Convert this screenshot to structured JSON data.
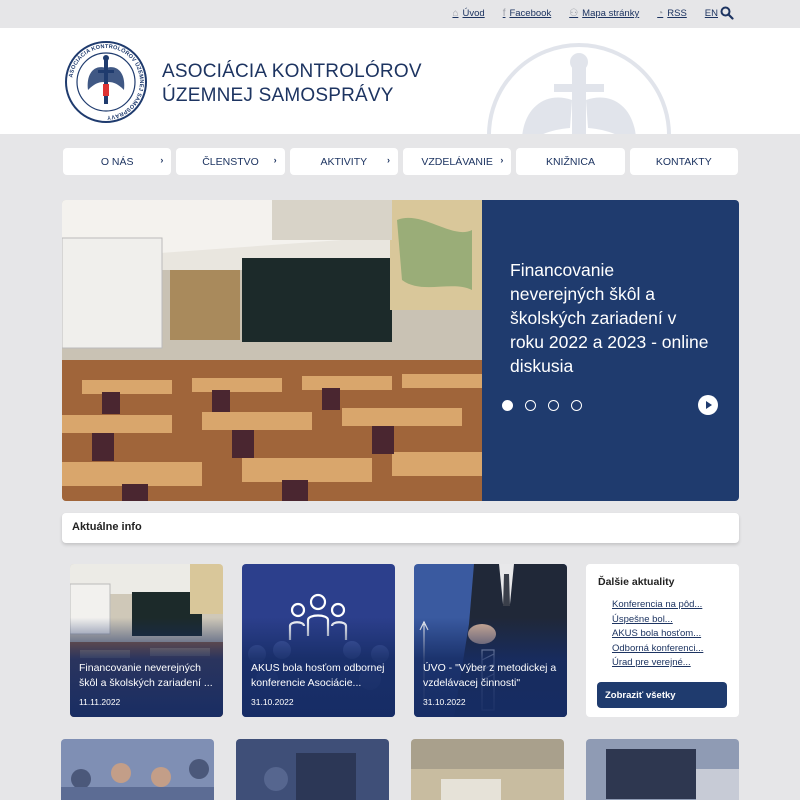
{
  "top_links": [
    {
      "label": "Úvod",
      "icon": "home-icon"
    },
    {
      "label": "Facebook",
      "icon": "facebook-icon"
    },
    {
      "label": "Mapa stránky",
      "icon": "sitemap-icon"
    },
    {
      "label": "RSS",
      "icon": "rss-icon"
    },
    {
      "label": "EN",
      "icon": ""
    }
  ],
  "brand": {
    "line1": "ASOCIÁCIA KONTROLÓROV",
    "line2": "ÚZEMNEJ SAMOSPRÁVY",
    "logo_ring_text": "ASOCIÁCIA KONTROLÓROV ÚZEMNEJ SAMOSPRÁVY"
  },
  "nav": [
    {
      "label": "O NÁS",
      "has_submenu": true
    },
    {
      "label": "ČLENSTVO",
      "has_submenu": true
    },
    {
      "label": "AKTIVITY",
      "has_submenu": true
    },
    {
      "label": "VZDELÁVANIE",
      "has_submenu": true
    },
    {
      "label": "KNIŽNICA",
      "has_submenu": false
    },
    {
      "label": "KONTAKTY",
      "has_submenu": false
    }
  ],
  "hero": {
    "title": "Financovanie neverejných škôl a školských zariadení v roku 2022 a 2023 - online diskusia",
    "slide_count": 4,
    "active_slide": 1
  },
  "info": {
    "heading": "Aktuálne info"
  },
  "news": [
    {
      "title": "Financovanie neverejných škôl a školských zariadení ...",
      "date": "11.11.2022"
    },
    {
      "title": "AKUS bola hosťom odbornej konferencie Asociácie...",
      "date": "31.10.2022"
    },
    {
      "title": "ÚVO - \"Výber z metodickej a vzdelávacej činnosti\"",
      "date": "31.10.2022"
    }
  ],
  "more_news": {
    "heading": "Ďalšie aktuality",
    "items": [
      "Konferencia na pôd...",
      "Úspešne bol...",
      "AKUS bola hosťom...",
      "Odborná konferenci...",
      "Úrad pre verejné..."
    ],
    "button": "Zobraziť všetky"
  },
  "colors": {
    "navy": "#1f3b6e",
    "text": "#1d3461",
    "background": "#e6e6e8"
  }
}
